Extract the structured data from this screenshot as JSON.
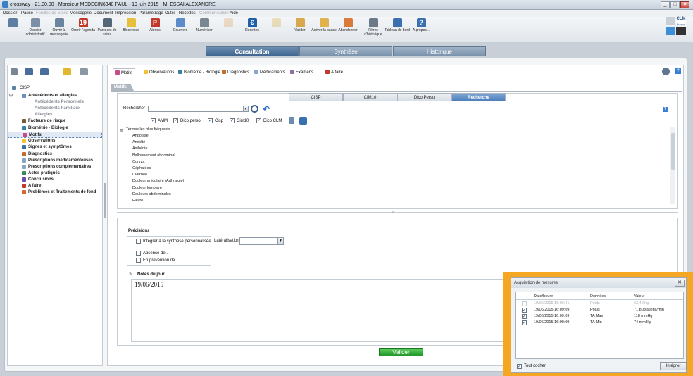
{
  "window": {
    "title": "crossway - 21.00.00 - Monsieur MEDECIN6340 PAUL - 19 juin 2015 - M. ESSAI ALEXANDRE",
    "min": "_",
    "max": "□",
    "close": "✕"
  },
  "menu": [
    {
      "label": "Dossier",
      "disabled": false
    },
    {
      "label": "Pause",
      "disabled": false
    },
    {
      "label": "Feuilles de Soins",
      "disabled": true
    },
    {
      "label": "Messagerie",
      "disabled": false
    },
    {
      "label": "Document",
      "disabled": false
    },
    {
      "label": "Impression",
      "disabled": false
    },
    {
      "label": "Paramétrage",
      "disabled": false
    },
    {
      "label": "Outils",
      "disabled": false
    },
    {
      "label": "Recettes",
      "disabled": false
    },
    {
      "label": "Communication",
      "disabled": true
    },
    {
      "label": "Aide",
      "disabled": false
    }
  ],
  "toolbar": [
    {
      "label": "",
      "icon": "user-icon",
      "color": "#5d7fa3"
    },
    {
      "label": "Dossier administratif",
      "icon": "folder-icon",
      "color": "#7b8fa6"
    },
    {
      "label": "Ouvrir la messagerie",
      "icon": "mail-icon",
      "color": "#6b84a0"
    },
    {
      "label": "Ouvrir l'agenda",
      "icon": "calendar-icon",
      "color": "#c0392b",
      "glyph": "19"
    },
    {
      "label": "Parcours de soins",
      "icon": "path-icon",
      "color": "#556677"
    },
    {
      "label": "Bloc notes",
      "icon": "notepad-icon",
      "color": "#e6c03a"
    },
    {
      "label": "Alertes",
      "icon": "alert-icon",
      "color": "#c0392b",
      "glyph": "P"
    },
    {
      "label": "Courriers",
      "icon": "letter-icon",
      "color": "#5b8bc9"
    },
    {
      "label": "Numériser",
      "icon": "scanner-icon",
      "color": "#7a8794"
    },
    {
      "label": "",
      "icon": "doc-icon",
      "color": "#d9a86c",
      "disabled": true
    },
    {
      "label": "Recettes",
      "icon": "euro-icon",
      "color": "#1d5fa8",
      "glyph": "€"
    },
    {
      "label": "",
      "icon": "card-icon",
      "color": "#d6b34a",
      "disabled": true
    },
    {
      "label": "Valider",
      "icon": "validate-icon",
      "color": "#d8a84e"
    },
    {
      "label": "Activer la pause",
      "icon": "pause-icon",
      "color": "#e0b34f"
    },
    {
      "label": "Abandonner",
      "icon": "abandon-icon",
      "color": "#d9793a"
    },
    {
      "label": "Filtres d'historique",
      "icon": "filter-icon",
      "color": "#6c7a88"
    },
    {
      "label": "Tableau de bord",
      "icon": "dashboard-icon",
      "color": "#3a6fb0"
    },
    {
      "label": "A propos...",
      "icon": "help-icon",
      "color": "#3a6fb0",
      "glyph": "?"
    }
  ],
  "logo": {
    "text": "CLM",
    "subtext": "France"
  },
  "main_tabs": [
    {
      "label": "Consultation",
      "active": true
    },
    {
      "label": "Synthèse",
      "active": false
    },
    {
      "label": "Historique",
      "active": false
    }
  ],
  "left_tree": [
    {
      "label": "CISP",
      "style": "plain",
      "icon": "cisp-icon",
      "color": "#5b7fa8"
    },
    {
      "label": "Antécédents et allergies",
      "style": "bold",
      "icon": "allergy-icon",
      "color": "#6a8fbd"
    },
    {
      "label": "Antécédents Personnels",
      "style": "sub"
    },
    {
      "label": "Antécédents Familiaux",
      "style": "sub"
    },
    {
      "label": "Allergies",
      "style": "sub"
    },
    {
      "label": "Facteurs de risque",
      "style": "bold",
      "icon": "risk-icon",
      "color": "#7a5b3a"
    },
    {
      "label": "Biométrie - Biologie",
      "style": "bold",
      "icon": "bio-icon",
      "color": "#3a7fa8"
    },
    {
      "label": "Motifs",
      "style": "bold",
      "selected": true,
      "icon": "motifs-icon",
      "color": "#c94a8a"
    },
    {
      "label": "Observations",
      "style": "bold",
      "icon": "obs-icon",
      "color": "#f2c230"
    },
    {
      "label": "Signes et symptômes",
      "style": "bold",
      "icon": "signs-icon",
      "color": "#3a6fa8"
    },
    {
      "label": "Diagnostics",
      "style": "bold",
      "icon": "diag-icon",
      "color": "#c46b2e"
    },
    {
      "label": "Prescriptions médicamenteuses",
      "style": "bold",
      "icon": "presc-icon",
      "color": "#8aa4c4"
    },
    {
      "label": "Prescriptions complémentaires",
      "style": "bold",
      "icon": "presc2-icon",
      "color": "#8aa4c4"
    },
    {
      "label": "Actes pratiqués",
      "style": "bold",
      "icon": "acts-icon",
      "color": "#3a8a5a"
    },
    {
      "label": "Conclusions",
      "style": "bold",
      "icon": "concl-icon",
      "color": "#6a4fa8"
    },
    {
      "label": "A faire",
      "style": "bold",
      "icon": "todo-icon",
      "color": "#c0392b"
    },
    {
      "label": "Problèmes et Traitements de fond",
      "style": "bold",
      "icon": "star-icon",
      "color": "#d9662e"
    }
  ],
  "section_tabs": [
    {
      "label": "Motifs",
      "active": true,
      "color": "#c94a8a"
    },
    {
      "label": "Observations",
      "color": "#f2c230"
    },
    {
      "label": "Biométrie - Biologie",
      "color": "#3a7fa8"
    },
    {
      "label": "Diagnostics",
      "color": "#c46b2e"
    },
    {
      "label": "Médicaments",
      "color": "#8aa4c4"
    },
    {
      "label": "Examens",
      "color": "#8a6fa8"
    },
    {
      "label": "A faire",
      "color": "#c0392b"
    }
  ],
  "motifs": {
    "header": "Motifs",
    "code_tabs": [
      {
        "label": "CISP",
        "active": false
      },
      {
        "label": "CIM10",
        "active": false
      },
      {
        "label": "Dico Perso",
        "active": false
      },
      {
        "label": "Recherche",
        "active": true
      }
    ],
    "search_label": "Rechercher",
    "search_value": "",
    "filters": [
      {
        "label": "AMM",
        "checked": true
      },
      {
        "label": "Dico perso",
        "checked": true
      },
      {
        "label": "Cisp",
        "checked": true
      },
      {
        "label": "Cim10",
        "checked": true
      },
      {
        "label": "Dico CLM",
        "checked": true
      }
    ],
    "list_header": "Termes les plus fréquents",
    "list_items": [
      "Angoisse",
      "Anxiété",
      "Asthénie",
      "Ballonnement abdominal",
      "Coryza",
      "Céphalées",
      "Diarrhée",
      "Douleur articulaire (Arthralgie)",
      "Douleur lombaire",
      "Douleurs abdominales",
      "Fièvre"
    ]
  },
  "precisions": {
    "title": "Précisions",
    "options": [
      "Intégrer à la synthèse personnalisée",
      "Absence de...",
      "En prévention de..."
    ],
    "lateralisation_label": "Latéralisation",
    "lateralisation_value": "",
    "notes_label": "Notes du jour",
    "notes_text": "19/06/2015 :",
    "validate": "Valider"
  },
  "popup": {
    "title": "Acquisition de mesures",
    "columns": [
      "Date/heure",
      "Données",
      "Valeur"
    ],
    "rows": [
      {
        "checked": false,
        "disabled": true,
        "date": "19/06/2015 16:06:41",
        "donnee": "Poids",
        "valeur": "63,40 kg"
      },
      {
        "checked": true,
        "disabled": false,
        "date": "19/06/2015 16:09:09",
        "donnee": "Pouls",
        "valeur": "71 pulsations/min"
      },
      {
        "checked": true,
        "disabled": false,
        "date": "19/06/2015 16:09:09",
        "donnee": "TA Max",
        "valeur": "118 mmHg"
      },
      {
        "checked": true,
        "disabled": false,
        "date": "19/06/2015 16:09:09",
        "donnee": "TA Min",
        "valeur": "74 mmHg"
      }
    ],
    "check_all": "Tout cocher",
    "integrate": "Intégrer",
    "close": "✕"
  },
  "colors": {
    "highlight": "#f5a623",
    "accent": "#4e7fbb",
    "validate": "#23962a"
  }
}
